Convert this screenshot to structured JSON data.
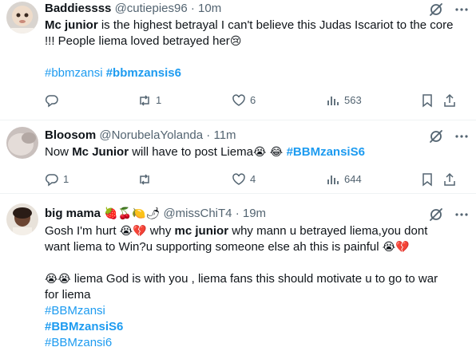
{
  "tweets": [
    {
      "name": "Baddiessss",
      "handle": "@cutiepies96",
      "sep": "·",
      "time": "10m",
      "body": {
        "mention": "Mc junior",
        "text": " is the highest betrayal I can't believe this Judas Iscariot to the core !!! People liema loved betrayed her",
        "emoji": "😢",
        "tag1": "#bbmzansi",
        "tag2": "#bbmzansis6"
      },
      "replies": "",
      "retweets": "1",
      "likes": "6",
      "views": "563"
    },
    {
      "name": "Bloosom",
      "handle": "@NorubelaYolanda",
      "sep": "·",
      "time": "11m",
      "body": {
        "pre": "Now ",
        "mention": "Mc Junior",
        "text": " will have to post  Liema",
        "emoji": "😭 😂 ",
        "tag": "#BBMzansiS6"
      },
      "replies": "1",
      "retweets": "",
      "likes": "4",
      "views": "644"
    },
    {
      "name": "big mama",
      "name_emoji": "🍓🍒🍋🌶",
      "handle": "@missChiT4",
      "sep": "·",
      "time": "19m",
      "body": {
        "l1_pre": "Gosh I'm hurt ",
        "l1_emo": "😭💔",
        "l1_mid": " why ",
        "mention": "mc junior",
        "l1_rest": " why mann u betrayed liema,you dont",
        "l2": "want liema to Win?u supporting someone else  ah this is painful ",
        "l2_emo": "😭💔",
        "l3_emo": "😭😭",
        "l3": " liema God is with you , liema fans this should motivate u to go to war",
        "l4": "for liema",
        "tag1": "#BBMzansi",
        "tag2": "#BBMzansiS6",
        "tag3": "#BBMzansi6"
      }
    }
  ],
  "icons": [
    "grok-icon",
    "more-icon",
    "reply-icon",
    "retweet-icon",
    "like-icon",
    "views-icon",
    "bookmark-icon",
    "share-icon"
  ],
  "colors": {
    "accent": "#1d9bf0",
    "text": "#0f1419",
    "muted": "#536471",
    "divider": "#eff3f4"
  }
}
